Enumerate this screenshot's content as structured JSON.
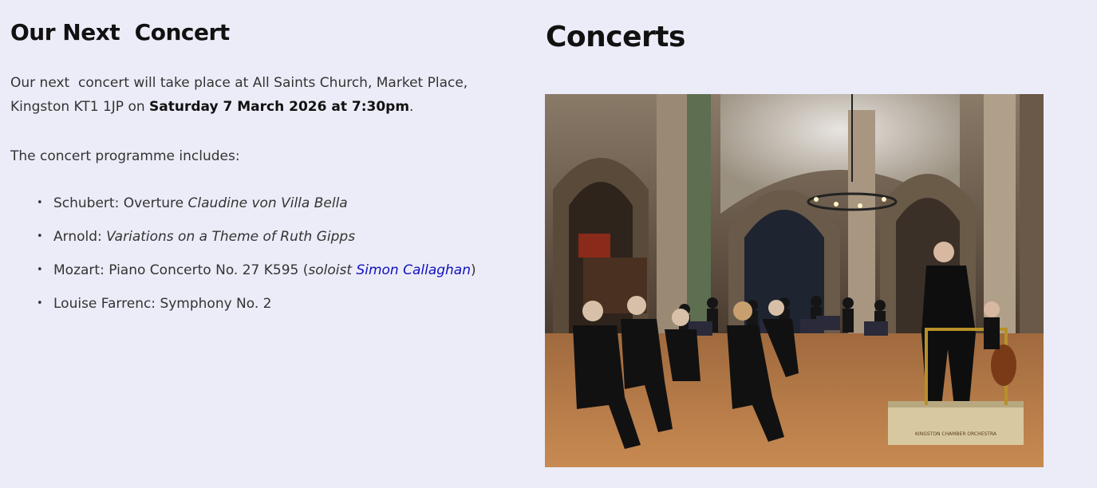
{
  "next_concert": {
    "heading": "Our Next  Concert",
    "intro_prefix": "Our next  concert will take place at All Saints Church, Market Place, Kingston KT1 1JP on ",
    "intro_date": "Saturday 7 March 2026 at 7:30pm",
    "intro_suffix": ".",
    "programme_label": "The concert programme includes:",
    "programme": [
      {
        "composer": "Schubert: Overture ",
        "work": "Claudine von Villa Bella"
      },
      {
        "composer": "Arnold: ",
        "work": "Variations on a Theme of Ruth Gipps"
      },
      {
        "composer": "Mozart: Piano Concerto No. 27 K595 (",
        "soloist_label": "soloist ",
        "soloist_name": "Simon Callaghan",
        "suffix": ")"
      },
      {
        "composer": "Louise Farrenc: Symphony No. 2"
      }
    ],
    "bullet": "•"
  },
  "concerts": {
    "heading": "Concerts",
    "photo_podium_text": "KINGSTON CHAMBER ORCHESTRA"
  },
  "colors": {
    "background": "#ececf8",
    "link": "#1010c0",
    "heading": "#111111",
    "body_text": "#333333"
  }
}
